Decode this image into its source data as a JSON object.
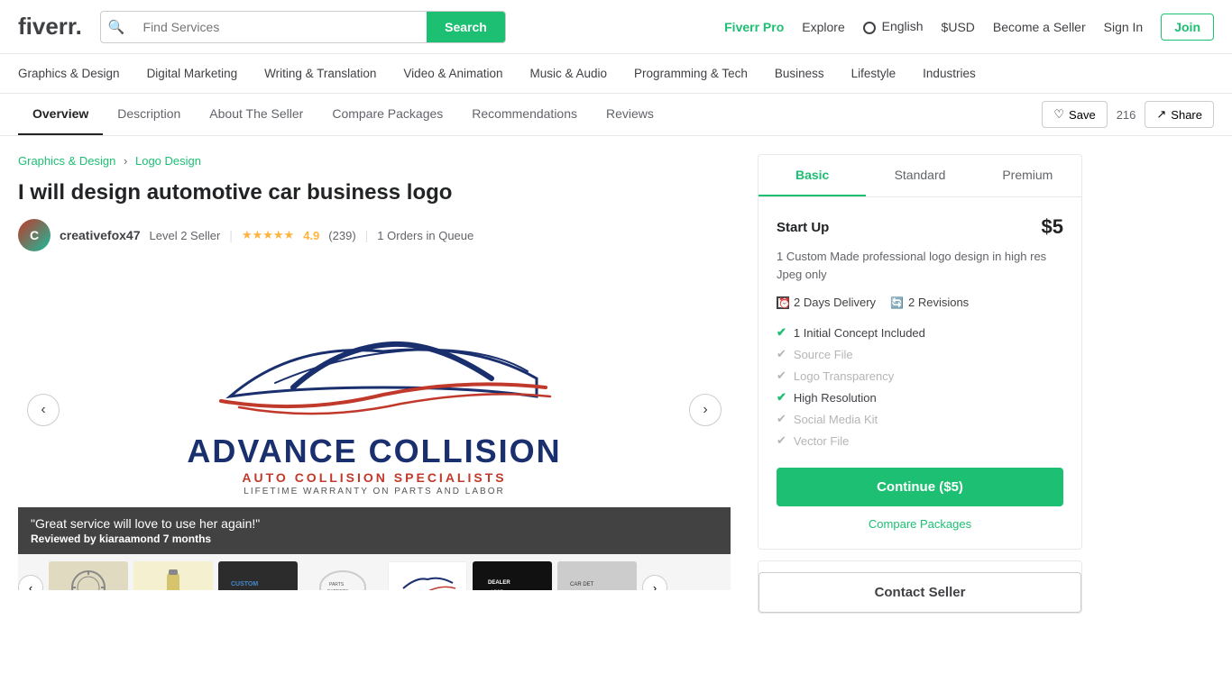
{
  "header": {
    "logo": "fiverr.",
    "search_placeholder": "Find Services",
    "search_btn": "Search",
    "nav": {
      "fiverr_pro": "Fiverr Pro",
      "explore": "Explore",
      "language": "English",
      "currency": "$USD",
      "become_seller": "Become a Seller",
      "sign_in": "Sign In",
      "join": "Join"
    }
  },
  "categories": [
    "Graphics & Design",
    "Digital Marketing",
    "Writing & Translation",
    "Video & Animation",
    "Music & Audio",
    "Programming & Tech",
    "Business",
    "Lifestyle",
    "Industries"
  ],
  "tabs": [
    {
      "label": "Overview",
      "active": true
    },
    {
      "label": "Description",
      "active": false
    },
    {
      "label": "About The Seller",
      "active": false
    },
    {
      "label": "Compare Packages",
      "active": false
    },
    {
      "label": "Recommendations",
      "active": false
    },
    {
      "label": "Reviews",
      "active": false
    }
  ],
  "tab_actions": {
    "save": "Save",
    "count": "216",
    "share": "Share"
  },
  "breadcrumb": {
    "category": "Graphics & Design",
    "subcategory": "Logo Design",
    "separator": "›"
  },
  "gig": {
    "title": "I will design automotive car business logo",
    "seller": {
      "name": "creativefox47",
      "level": "Level 2 Seller",
      "rating": "4.9",
      "review_count": "(239)",
      "queue": "1 Orders in Queue"
    }
  },
  "review_overlay": {
    "quote": "\"Great service will love to use her again!\"",
    "by_label": "Reviewed by",
    "reviewer": "kiaraamond",
    "time": "7 months"
  },
  "package_panel": {
    "tabs": [
      {
        "label": "Basic",
        "active": true
      },
      {
        "label": "Standard",
        "active": false
      },
      {
        "label": "Premium",
        "active": false
      }
    ],
    "basic": {
      "title": "Start Up",
      "price": "$5",
      "description": "1 Custom Made professional logo design in high res Jpeg only",
      "delivery": "2 Days Delivery",
      "revisions": "2 Revisions",
      "features": [
        {
          "label": "1 Initial Concept Included",
          "included": true
        },
        {
          "label": "Source File",
          "included": false
        },
        {
          "label": "Logo Transparency",
          "included": false
        },
        {
          "label": "High Resolution",
          "included": true
        },
        {
          "label": "Social Media Kit",
          "included": false
        },
        {
          "label": "Vector File",
          "included": false
        }
      ],
      "continue_btn": "Continue ($5)",
      "compare_link": "Compare Packages"
    }
  },
  "contact_btn": "Contact Seller",
  "thumbnails": [
    {
      "bg": "#e8e8e8",
      "label": "compass"
    },
    {
      "bg": "#f0f0d8",
      "label": "bottle"
    },
    {
      "bg": "#2c2c2c",
      "label": "logo2"
    },
    {
      "bg": "#f5f5f5",
      "label": "emblem"
    },
    {
      "bg": "#fff",
      "label": "collision"
    },
    {
      "bg": "#111",
      "label": "dealer"
    },
    {
      "bg": "#ccc",
      "label": "car2"
    }
  ]
}
